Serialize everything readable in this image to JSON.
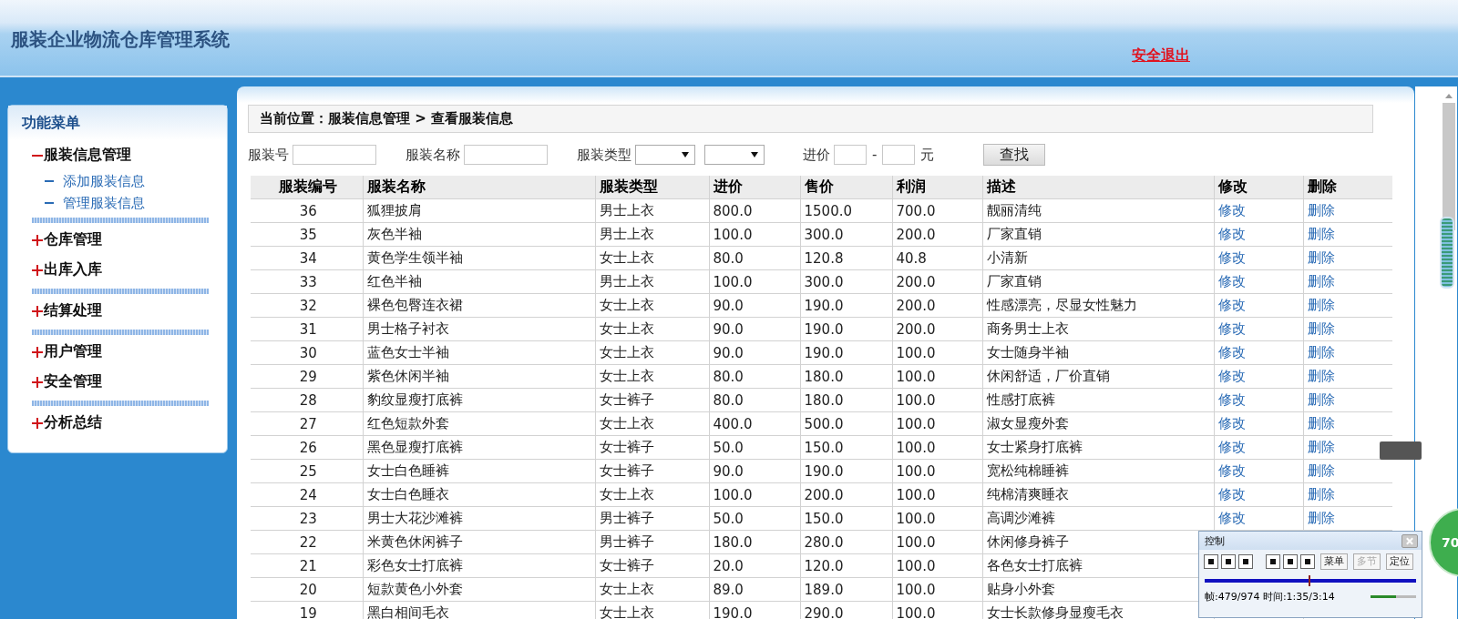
{
  "header": {
    "title": "服装企业物流仓库管理系统",
    "logout": "安全退出"
  },
  "sidebar": {
    "title": "功能菜单",
    "sections": [
      [
        {
          "label": "服装信息管理",
          "expanded": true,
          "children": [
            {
              "label": "添加服装信息"
            },
            {
              "label": "管理服装信息"
            }
          ]
        }
      ],
      [
        {
          "label": "仓库管理",
          "expanded": false
        },
        {
          "label": "出库入库",
          "expanded": false
        }
      ],
      [
        {
          "label": "结算处理",
          "expanded": false
        }
      ],
      [
        {
          "label": "用户管理",
          "expanded": false
        },
        {
          "label": "安全管理",
          "expanded": false
        }
      ],
      [
        {
          "label": "分析总结",
          "expanded": false
        }
      ]
    ]
  },
  "breadcrumb": "当前位置：服装信息管理 > 查看服装信息",
  "search": [
    {
      "kind": "label",
      "text": "服装号"
    },
    {
      "kind": "input"
    },
    {
      "kind": "label",
      "text": "服装名称"
    },
    {
      "kind": "input"
    },
    {
      "kind": "label",
      "text": "服装类型"
    },
    {
      "kind": "select"
    },
    {
      "kind": "select"
    },
    {
      "kind": "label",
      "text": "进价"
    },
    {
      "kind": "input"
    },
    {
      "kind": "unit",
      "text": "-"
    },
    {
      "kind": "input"
    },
    {
      "kind": "unit",
      "text": "元"
    },
    {
      "kind": "button",
      "text": "查找"
    }
  ],
  "table": {
    "columns": [
      {
        "label": "服装编号",
        "kind": "number"
      },
      {
        "label": "服装名称",
        "kind": "text"
      },
      {
        "label": "服装类型",
        "kind": "text"
      },
      {
        "label": "进价",
        "kind": "text"
      },
      {
        "label": "售价",
        "kind": "text"
      },
      {
        "label": "利润",
        "kind": "text"
      },
      {
        "label": "描述",
        "kind": "text"
      },
      {
        "label": "修改",
        "kind": "link"
      },
      {
        "label": "删除",
        "kind": "link"
      }
    ],
    "rows": [
      [
        "36",
        "狐狸披肩",
        "男士上衣",
        "800.0",
        "1500.0",
        "700.0",
        "靓丽清纯",
        "修改",
        "删除"
      ],
      [
        "35",
        "灰色半袖",
        "男士上衣",
        "100.0",
        "300.0",
        "200.0",
        "厂家直销",
        "修改",
        "删除"
      ],
      [
        "34",
        "黄色学生领半袖",
        "女士上衣",
        "80.0",
        "120.8",
        "40.8",
        "小清新",
        "修改",
        "删除"
      ],
      [
        "33",
        "红色半袖",
        "男士上衣",
        "100.0",
        "300.0",
        "200.0",
        "厂家直销",
        "修改",
        "删除"
      ],
      [
        "32",
        "裸色包臀连衣裙",
        "女士上衣",
        "90.0",
        "190.0",
        "200.0",
        "性感漂亮，尽显女性魅力",
        "修改",
        "删除"
      ],
      [
        "31",
        "男士格子衬衣",
        "女士上衣",
        "90.0",
        "190.0",
        "200.0",
        "商务男士上衣",
        "修改",
        "删除"
      ],
      [
        "30",
        "蓝色女士半袖",
        "女士上衣",
        "90.0",
        "190.0",
        "100.0",
        "女士随身半袖",
        "修改",
        "删除"
      ],
      [
        "29",
        "紫色休闲半袖",
        "女士上衣",
        "80.0",
        "180.0",
        "100.0",
        "休闲舒适，厂价直销",
        "修改",
        "删除"
      ],
      [
        "28",
        "豹纹显瘦打底裤",
        "女士裤子",
        "80.0",
        "180.0",
        "100.0",
        "性感打底裤",
        "修改",
        "删除"
      ],
      [
        "27",
        "红色短款外套",
        "女士上衣",
        "400.0",
        "500.0",
        "100.0",
        "淑女显瘦外套",
        "修改",
        "删除"
      ],
      [
        "26",
        "黑色显瘦打底裤",
        "女士裤子",
        "50.0",
        "150.0",
        "100.0",
        "女士紧身打底裤",
        "修改",
        "删除"
      ],
      [
        "25",
        "女士白色睡裤",
        "女士裤子",
        "90.0",
        "190.0",
        "100.0",
        "宽松纯棉睡裤",
        "修改",
        "删除"
      ],
      [
        "24",
        "女士白色睡衣",
        "女士上衣",
        "100.0",
        "200.0",
        "100.0",
        "纯棉清爽睡衣",
        "修改",
        "删除"
      ],
      [
        "23",
        "男士大花沙滩裤",
        "男士裤子",
        "50.0",
        "150.0",
        "100.0",
        "高调沙滩裤",
        "修改",
        "删除"
      ],
      [
        "22",
        "米黄色休闲裤子",
        "男士裤子",
        "180.0",
        "280.0",
        "100.0",
        "休闲修身裤子"
      ],
      [
        "21",
        "彩色女士打底裤",
        "女士裤子",
        "20.0",
        "120.0",
        "100.0",
        "各色女士打底裤"
      ],
      [
        "20",
        "短款黄色小外套",
        "女士上衣",
        "89.0",
        "189.0",
        "100.0",
        "贴身小外套"
      ],
      [
        "19",
        "黑白相间毛衣",
        "女士上衣",
        "190.0",
        "290.0",
        "100.0",
        "女士长款修身显瘦毛衣"
      ]
    ]
  },
  "player": {
    "title": "控制",
    "buttons": [
      {
        "label": "菜单",
        "disabled": false
      },
      {
        "label": "多节",
        "disabled": true
      },
      {
        "label": "定位",
        "disabled": false
      }
    ],
    "progress": {
      "level": 0.49
    },
    "status": "帧:479/974 时间:1:35/3:14",
    "volume": {
      "level": 0.55
    }
  },
  "floating_badge": "70"
}
